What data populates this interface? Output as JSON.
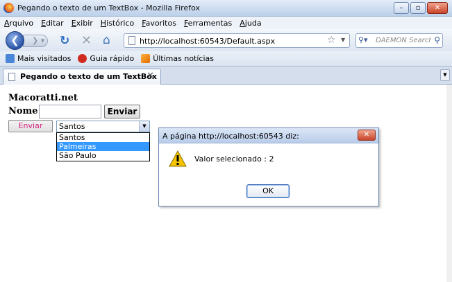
{
  "window": {
    "title": "Pegando o texto de um TextBox - Mozilla Firefox",
    "minimize_glyph": "–",
    "maximize_glyph": "▫",
    "close_glyph": "✕"
  },
  "menubar": {
    "items": [
      {
        "hotkey": "A",
        "rest": "rquivo"
      },
      {
        "hotkey": "E",
        "rest": "ditar"
      },
      {
        "hotkey": "E",
        "rest": "xibir"
      },
      {
        "hotkey": "H",
        "rest": "istórico"
      },
      {
        "hotkey": "F",
        "rest": "avoritos"
      },
      {
        "hotkey": "F",
        "rest": "erramentas"
      },
      {
        "hotkey": "Aj",
        "rest": "uda"
      }
    ]
  },
  "navbar": {
    "back_glyph": "❮",
    "forward_glyph": "❯ ▾",
    "reload_glyph": "↻",
    "stop_glyph": "✕",
    "home_glyph": "⌂",
    "url": "http://localhost:60543/Default.aspx",
    "star_glyph": "☆",
    "dropdown_glyph": "▼",
    "search_engine_glyph": "⚲▾",
    "search_placeholder": "DAEMON Search",
    "search_go_glyph": "⚲"
  },
  "bookmarks": {
    "items": [
      "Mais visitados",
      "Guia rápido",
      "Últimas notícias"
    ]
  },
  "tabs": {
    "active_label": "Pegando o texto de um TextBox",
    "close_glyph": "✕",
    "list_glyph": "▼"
  },
  "page": {
    "site_title": "Macoratti.net",
    "nome_label": "Nome:",
    "nome_value": "",
    "enviar_label": "Enviar",
    "enviar2_label": "Enviar",
    "select": {
      "value": "Santos",
      "arrow_glyph": "▼",
      "options": [
        "Santos",
        "Palmeiras",
        "São Paulo"
      ],
      "highlighted_index": 1
    }
  },
  "dialog": {
    "title": "A página http://localhost:60543 diz:",
    "close_glyph": "✕",
    "message": "Valor selecionado : 2",
    "ok_label": "OK"
  },
  "colors": {
    "highlight": "#3399ff",
    "link_pink": "#d4237a",
    "chrome_blue": "#bcd0ea"
  }
}
